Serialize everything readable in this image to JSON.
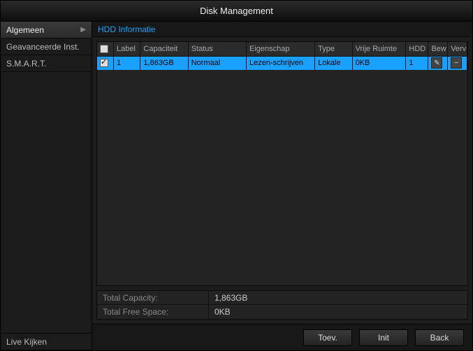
{
  "title": "Disk Management",
  "sidebar": {
    "items": [
      {
        "label": "Algemeen",
        "active": true
      },
      {
        "label": "Geavanceerde Inst.",
        "active": false
      },
      {
        "label": "S.M.A.R.T.",
        "active": false
      }
    ],
    "footer_label": "Live Kijken"
  },
  "section_title": "HDD Informatie",
  "table": {
    "headers": [
      "",
      "Label",
      "Capaciteit",
      "Status",
      "Eigenschap",
      "Type",
      "Vrije Ruimte",
      "HDD",
      "Bew",
      "Verv"
    ],
    "rows": [
      {
        "checked": true,
        "label": "1",
        "capacity": "1,863GB",
        "status": "Normaal",
        "property": "Lezen-schrijven",
        "type": "Lokale",
        "free": "0KB",
        "hdd": "1",
        "selected": true
      }
    ]
  },
  "summary": {
    "total_capacity_label": "Total Capacity:",
    "total_capacity_value": "1,863GB",
    "total_free_label": "Total Free Space:",
    "total_free_value": "0KB"
  },
  "buttons": {
    "add": "Toev.",
    "init": "Init",
    "back": "Back"
  }
}
